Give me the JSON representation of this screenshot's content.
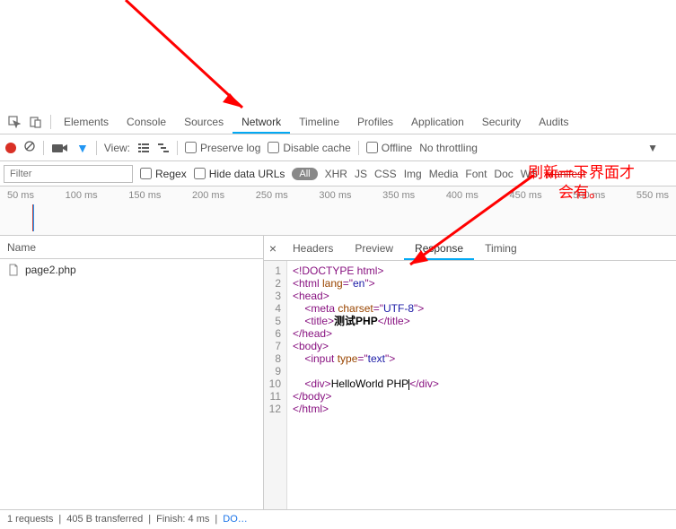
{
  "tabs": [
    "Elements",
    "Console",
    "Sources",
    "Network",
    "Timeline",
    "Profiles",
    "Application",
    "Security",
    "Audits"
  ],
  "activeTab": 3,
  "toolbar": {
    "view": "View:",
    "preserve": "Preserve log",
    "disable": "Disable cache",
    "offline": "Offline",
    "throttle": "No throttling"
  },
  "filter": {
    "placeholder": "Filter",
    "regex": "Regex",
    "hide": "Hide data URLs"
  },
  "filterTypes": [
    "All",
    "XHR",
    "JS",
    "CSS",
    "Img",
    "Media",
    "Font",
    "Doc",
    "WS"
  ],
  "timeline": [
    "50 ms",
    "100 ms",
    "150 ms",
    "200 ms",
    "250 ms",
    "300 ms",
    "350 ms",
    "400 ms",
    "450 ms",
    "500 ms",
    "550 ms"
  ],
  "left": {
    "header": "Name",
    "file": "page2.php"
  },
  "subtabs": [
    "Headers",
    "Preview",
    "Response",
    "Timing"
  ],
  "activeSub": 2,
  "code": {
    "lines": [
      1,
      2,
      3,
      4,
      5,
      6,
      7,
      8,
      9,
      10,
      11,
      12
    ],
    "l1": {
      "a": "<!DOCTYPE html>"
    },
    "l2": {
      "a": "<html ",
      "b": "lang",
      "c": "=\"",
      "d": "en",
      "e": "\">"
    },
    "l3": {
      "a": "<head>"
    },
    "l4": {
      "a": "    <meta ",
      "b": "charset",
      "c": "=\"",
      "d": "UTF-8",
      "e": "\">"
    },
    "l5": {
      "a": "    <title>",
      "b": "测试PHP",
      "c": "</title>"
    },
    "l6": {
      "a": "</head>"
    },
    "l7": {
      "a": "<body>"
    },
    "l8": {
      "a": "    <input ",
      "b": "type",
      "c": "=\"",
      "d": "text",
      "e": "\">"
    },
    "l10": {
      "a": "    <div>",
      "b": "HelloWorld PHP",
      "c": "</div>"
    },
    "l11": {
      "a": "</body>"
    },
    "l12": {
      "a": "</html>"
    }
  },
  "status": {
    "req": "1 requests",
    "xfer": "405 B transferred",
    "finish": "Finish: 4 ms",
    "dom": "DO…"
  },
  "annotation": {
    "text1": "刷新一下界面才",
    "text2": "会有。",
    "target": "Manifest"
  }
}
